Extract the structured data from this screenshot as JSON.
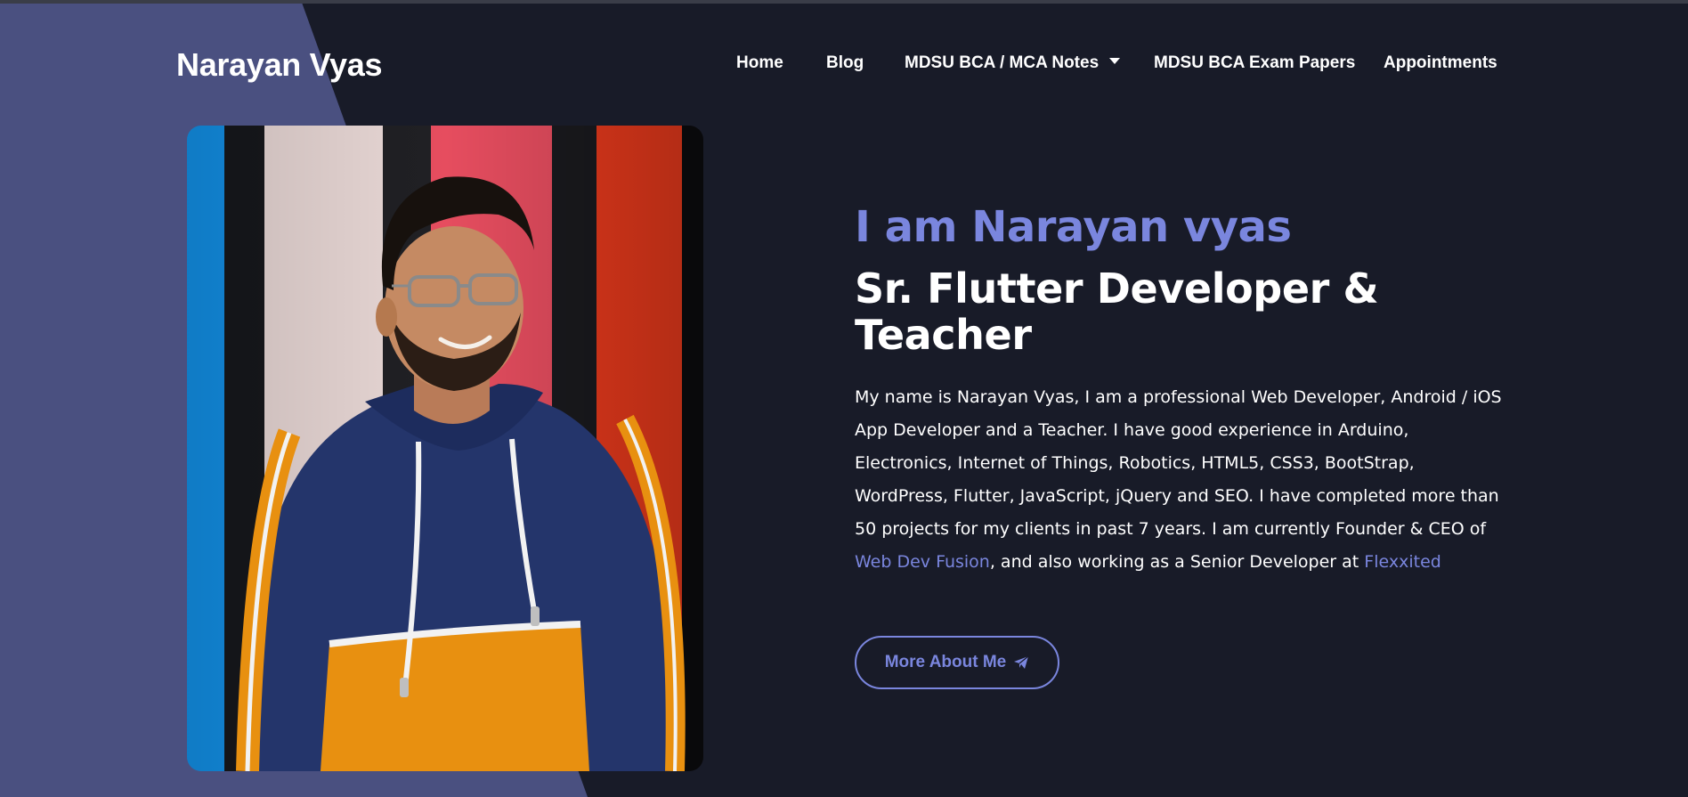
{
  "brand": {
    "name": "Narayan Vyas"
  },
  "nav": {
    "items": [
      {
        "label": "Home"
      },
      {
        "label": "Blog"
      },
      {
        "label": "MDSU BCA / MCA Notes",
        "icon": "caret-down-icon"
      },
      {
        "label": "MDSU BCA Exam Papers"
      },
      {
        "label": "Appointments"
      }
    ]
  },
  "hero": {
    "intro": "I am Narayan vyas",
    "role_line1": "Sr. Flutter Developer &",
    "role_line2": "Teacher",
    "bio_part1": "My name is Narayan Vyas, I am a professional Web Developer, Android / iOS App Developer and a Teacher. I have good experience in Arduino, Electronics, Internet of Things, Robotics, HTML5, CSS3, BootStrap, WordPress, Flutter, JavaScript, jQuery and SEO. I have completed more than 50 projects for my clients in past 7 years. I am currently Founder & CEO of ",
    "bio_link1": "Web Dev Fusion",
    "bio_part2": ", and also working as a Senior Developer at ",
    "bio_link2": "Flexxited",
    "button_label": "More About Me",
    "button_icon": "paper-plane-icon",
    "photo_alt": "Narayan Vyas"
  },
  "colors": {
    "background": "#181b28",
    "panel": "#4a5080",
    "accent": "#7a86de",
    "text": "#ffffff"
  }
}
